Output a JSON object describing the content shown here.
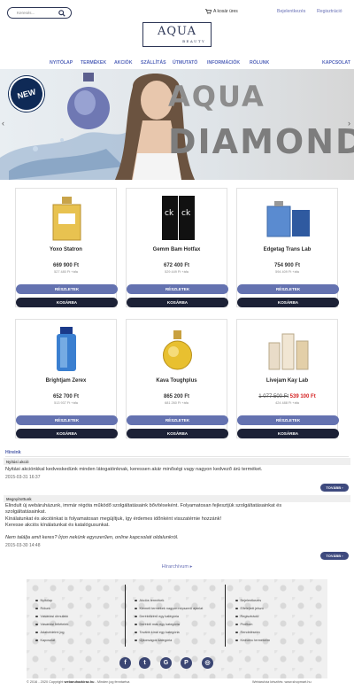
{
  "header": {
    "search_placeholder": "Keresés...",
    "cart_label": "A kosár üres",
    "login": "Bejelentkezés",
    "register": "Regisztráció"
  },
  "logo": {
    "main": "AQUA",
    "sub": "BEAUTY"
  },
  "nav": {
    "items": [
      "NYITÓLAP",
      "TERMÉKEK",
      "AKCIÓK",
      "SZÁLLÍTÁS",
      "ÚTMUTATÓ",
      "INFORMÁCIÓK",
      "RÓLUNK"
    ],
    "right": "KAPCSOLAT"
  },
  "hero": {
    "badge": "NEW",
    "title_line1": "AQUA",
    "title_line2": "DIAMOND",
    "prev": "‹",
    "next": "›"
  },
  "products": [
    {
      "name": "Yoxo Statron",
      "price": "669 900 Ft",
      "net": "527 480 Ft +áfa",
      "details": "RÉSZLETEK",
      "buy": "KOSÁRBA"
    },
    {
      "name": "Gemm Bam Hotfax",
      "price": "672 400 Ft",
      "net": "529 449 Ft +áfa",
      "details": "RÉSZLETEK",
      "buy": "KOSÁRBA"
    },
    {
      "name": "Edgetag Trans Lab",
      "price": "754 900 Ft",
      "net": "594 409 Ft +áfa",
      "details": "RÉSZLETEK",
      "buy": "KOSÁRBA"
    },
    {
      "name": "Brightjam Zerex",
      "price": "652 700 Ft",
      "net": "513 937 Ft +áfa",
      "details": "RÉSZLETEK",
      "buy": "KOSÁRBA"
    },
    {
      "name": "Kava Toughplus",
      "price": "865 200 Ft",
      "net": "681 260 Ft +áfa",
      "details": "RÉSZLETEK",
      "buy": "KOSÁRBA"
    },
    {
      "name": "Livejam Kay Lab",
      "old_price": "1 077 500 Ft",
      "price": "539 100 Ft",
      "net": "424 488 Ft +áfa",
      "details": "RÉSZLETEK",
      "buy": "KOSÁRBA"
    }
  ],
  "news": {
    "heading": "Híreink",
    "items": [
      {
        "title": "Nyitási akció",
        "text": "Nyitási akciónkkal kedveskedünk minden látogatónknak, keressen akár minőségi vagy nagyon kedvező árú terméket.",
        "date": "2015-03-31 16:37",
        "more": "TOVÁBB"
      },
      {
        "title": "Megnyitottunk",
        "lines": [
          "Elindult új webáruházunk, immár régóta működő szolgáltatásaink bővítéseként. Folyamatosan fejlesztjük szolgáltatásainkat és",
          "szolgáltatásainkat.",
          "Kínálatunkat és akcióinkat is folyamatosan megújítjuk, így érdemes időnként visszatérnie hozzánk!",
          "Keresse akciós kínálatunkat és katalógusunkat."
        ],
        "italic": "Nem találja amit keres? Írjon nekünk egyszerűen, online kapcsolati oldalunkról.",
        "date": "2015-03-30 14:48",
        "more": "TOVÁBB"
      }
    ],
    "archive": "Hírarchívum ▸"
  },
  "footer": {
    "col1": [
      "Nyitólap",
      "Rólunk",
      "Vásárlási útmutató",
      "Vásárlási feltételek",
      "Adatvédelmi jog",
      "Kapcsolat"
    ],
    "col2": [
      "Akciós termékek",
      "Kiemelt termékek nagyon népszerű ajánlat",
      "Deréktőzérű egy kategória",
      "Deréktő más egy kategória",
      "Tovább kínál egy kategória",
      "Újdonságok kategória"
    ],
    "col3": [
      "Bejelentkezés",
      "Elfelejtett jelszó",
      "Regisztráció",
      "Profilom",
      "Rendeléseim",
      "Kedvenc termékeim"
    ],
    "social": [
      "f",
      "t",
      "G",
      "P",
      "◎"
    ],
    "copyright_prefix": "© 2016 - 2020 Copyright",
    "copyright_site": "webaruhazkiraz.hu",
    "copyright_suffix": " - Minden jog fenntartva",
    "credit": "Webáruház készítés: www.shopmart.hu"
  },
  "colors": {
    "nav": "#5566bb",
    "dark_button": "#1c2136",
    "detail_button": "#6472b0",
    "sale": "#d42020"
  }
}
